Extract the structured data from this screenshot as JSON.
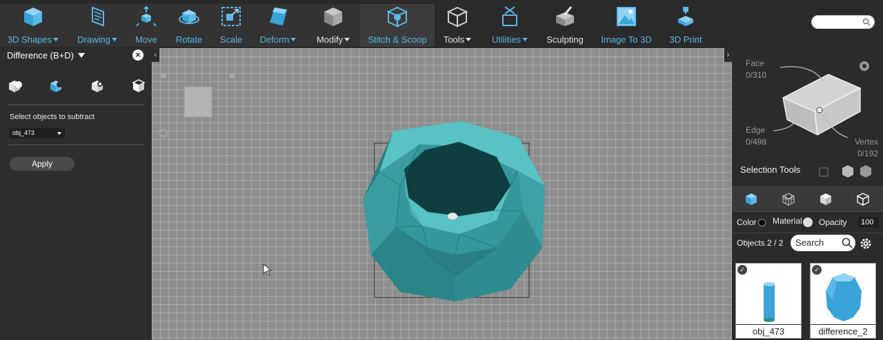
{
  "toolbar": {
    "items": [
      {
        "label": "3D Shapes",
        "has_menu": true,
        "icon": "cube-icon"
      },
      {
        "label": "Drawing",
        "has_menu": true,
        "icon": "drawing-icon"
      },
      {
        "label": "Move",
        "has_menu": false,
        "icon": "move-icon"
      },
      {
        "label": "Rotate",
        "has_menu": false,
        "icon": "rotate-icon"
      },
      {
        "label": "Scale",
        "has_menu": false,
        "icon": "scale-icon"
      },
      {
        "label": "Deform",
        "has_menu": true,
        "icon": "deform-icon"
      },
      {
        "label": "Modify",
        "has_menu": true,
        "icon": "modify-icon"
      },
      {
        "label": "Stitch & Scoop",
        "has_menu": false,
        "icon": "stitch-scoop-icon"
      },
      {
        "label": "Tools",
        "has_menu": true,
        "icon": "tools-icon"
      },
      {
        "label": "Utilities",
        "has_menu": true,
        "icon": "utilities-icon"
      },
      {
        "label": "Sculpting",
        "has_menu": false,
        "icon": "sculpting-icon"
      },
      {
        "label": "Image To 3D",
        "has_menu": false,
        "icon": "image-to-3d-icon"
      },
      {
        "label": "3D Print",
        "has_menu": false,
        "icon": "3d-print-icon"
      }
    ]
  },
  "left_panel": {
    "title": "Difference (B+D)",
    "subtract_label": "Select objects to subtract",
    "selected_object": "obj_473",
    "apply_label": "Apply"
  },
  "right_panel": {
    "face_label": "Face",
    "face_count": "0/310",
    "edge_label": "Edge",
    "edge_count": "0/498",
    "vertex_label": "Vertex",
    "vertex_count": "0/192",
    "selection_tools_label": "Selection Tools",
    "color_label": "Color",
    "material_label": "Material",
    "opacity_label": "Opacity",
    "opacity_value": "100",
    "objects_label": "Objects 2 / 2",
    "search_placeholder": "Search",
    "objects": [
      {
        "name": "obj_473"
      },
      {
        "name": "difference_2"
      }
    ]
  },
  "colors": {
    "accent": "#5cb8e8",
    "mesh": "#2f8f93",
    "viewport": "#8a8a8a"
  }
}
